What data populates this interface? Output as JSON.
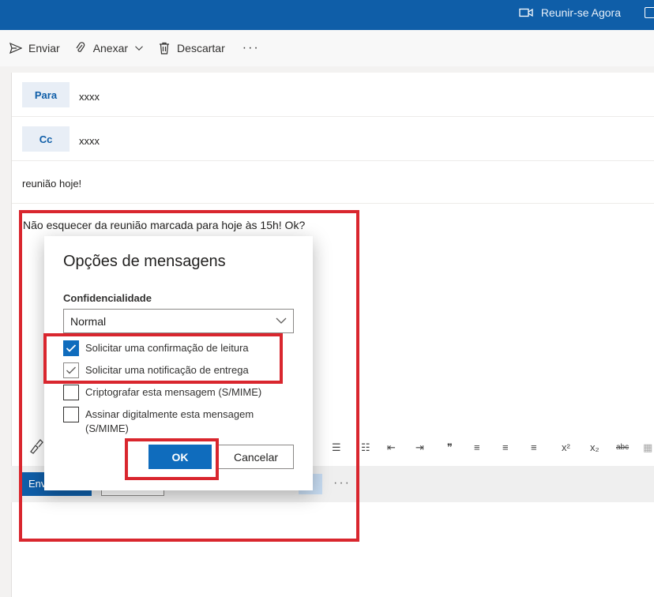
{
  "topbar": {
    "meet_label": "Reunir-se Agora",
    "bg": "#0f5ea8"
  },
  "toolbar": {
    "send_label": "Enviar",
    "attach_label": "Anexar",
    "discard_label": "Descartar",
    "more_label": "···"
  },
  "compose": {
    "to_label": "Para",
    "to_value": "xxxx",
    "cc_label": "Cc",
    "cc_value": "xxxx",
    "subject": "reunião hoje!",
    "body": "Não esquecer da reunião marcada para hoje às 15h! Ok?",
    "send_label": "Env",
    "more_label": "···"
  },
  "dialog": {
    "title": "Opções de mensagens",
    "confidentiality_label": "Confidencialidade",
    "confidentiality_value": "Normal",
    "options": [
      {
        "label": "Solicitar uma confirmação de leitura",
        "checked": true
      },
      {
        "label": "Solicitar uma notificação de entrega",
        "checked": true
      },
      {
        "label": "Criptografar esta mensagem (S/MIME)",
        "checked": false
      },
      {
        "label": "Assinar digitalmente esta mensagem (S/MIME)",
        "checked": false
      }
    ],
    "ok_label": "OK",
    "cancel_label": "Cancelar",
    "accent": "#0f6cbd"
  },
  "highlight_color": "#d9262e"
}
